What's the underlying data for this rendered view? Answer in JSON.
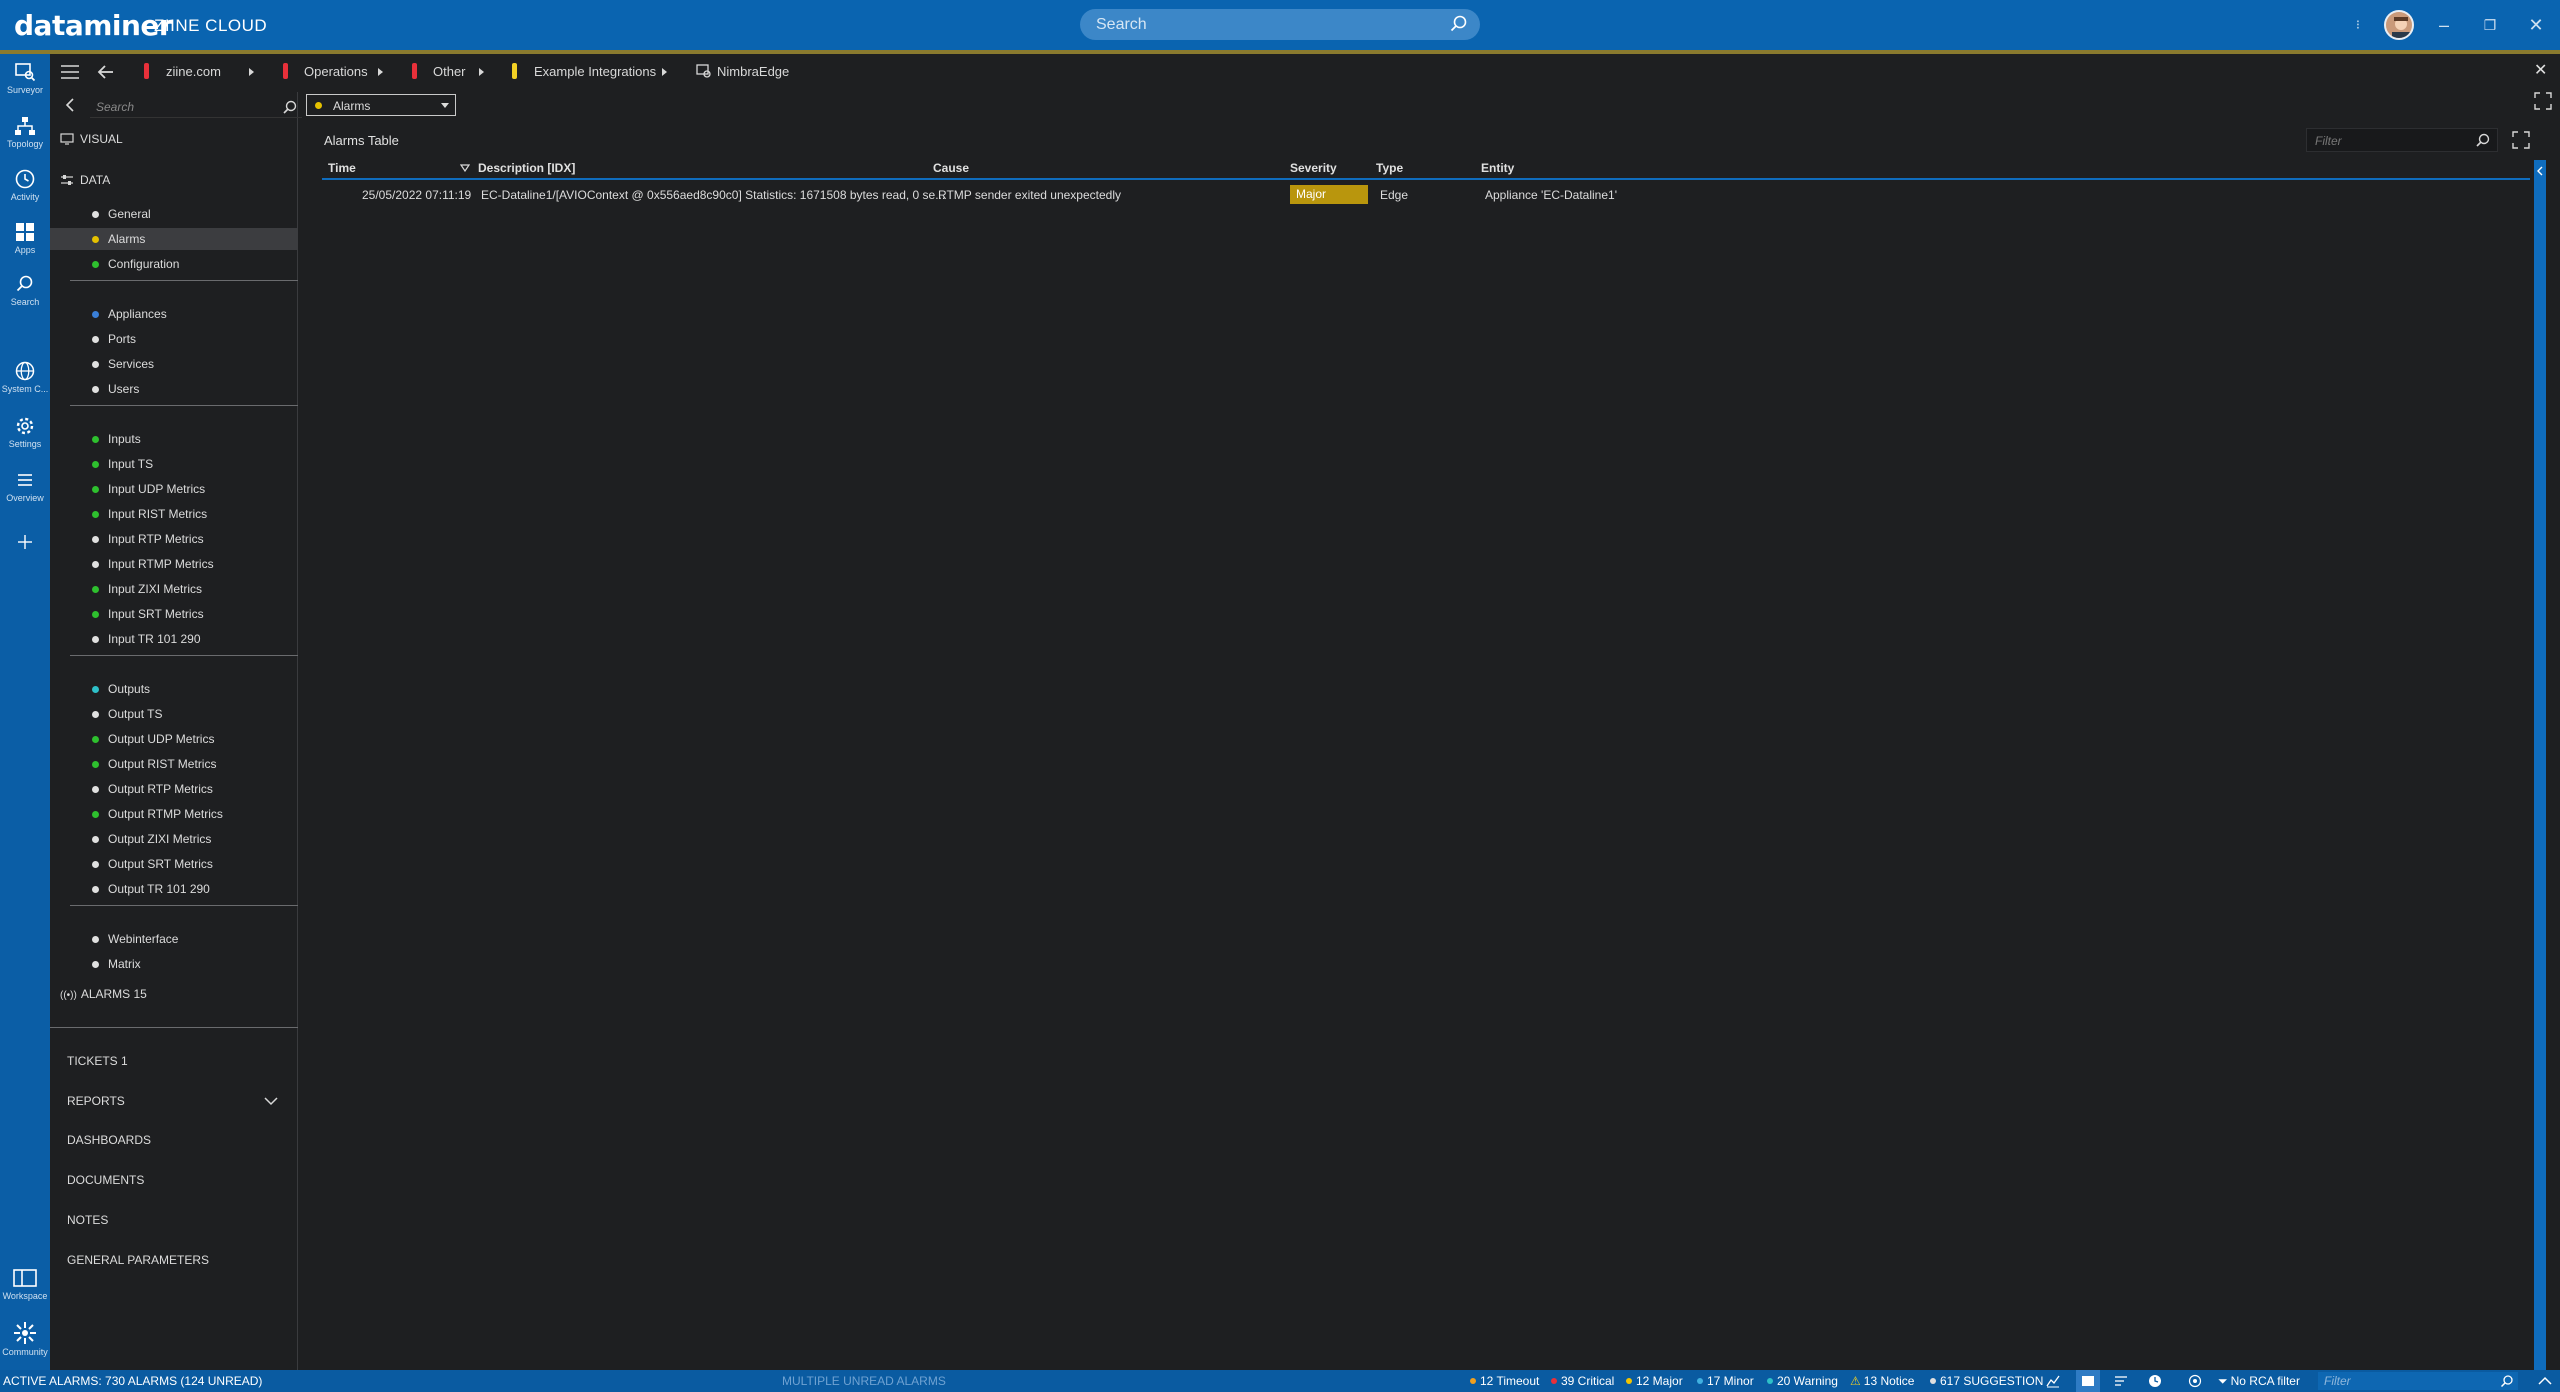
{
  "app": {
    "logo": "dataminer",
    "product": "ZIINE CLOUD"
  },
  "top_search": {
    "placeholder": "Search"
  },
  "rail": [
    {
      "label": "Surveyor",
      "icon": "surveyor-icon"
    },
    {
      "label": "Topology",
      "icon": "topology-icon"
    },
    {
      "label": "Activity",
      "icon": "activity-icon"
    },
    {
      "label": "Apps",
      "icon": "apps-icon"
    },
    {
      "label": "Search",
      "icon": "search-icon"
    },
    {
      "label": "System C...",
      "icon": "globe-icon"
    },
    {
      "label": "Settings",
      "icon": "gear-icon"
    },
    {
      "label": "Overview",
      "icon": "list-icon"
    },
    {
      "label": "",
      "icon": "plus-icon"
    },
    {
      "label": "Workspace",
      "icon": "workspace-icon"
    },
    {
      "label": "Community",
      "icon": "community-icon"
    }
  ],
  "breadcrumb": [
    {
      "label": "ziine.com",
      "flag": "#e8303a"
    },
    {
      "label": "Operations",
      "flag": "#e8303a"
    },
    {
      "label": "Other",
      "flag": "#e8303a"
    },
    {
      "label": "Example Integrations",
      "flag": "#f2d024"
    },
    {
      "label": "NimbraEdge"
    }
  ],
  "nav": {
    "search_placeholder": "Search",
    "visual_label": "VISUAL",
    "data_label": "DATA",
    "groups": [
      [
        {
          "label": "General",
          "color": "#e0e0e0"
        },
        {
          "label": "Alarms",
          "color": "#e5c100",
          "selected": true
        },
        {
          "label": "Configuration",
          "color": "#2ec02e"
        }
      ],
      [
        {
          "label": "Appliances",
          "color": "#3a7fd8"
        },
        {
          "label": "Ports",
          "color": "#e0e0e0"
        },
        {
          "label": "Services",
          "color": "#e0e0e0"
        },
        {
          "label": "Users",
          "color": "#e0e0e0"
        }
      ],
      [
        {
          "label": "Inputs",
          "color": "#2ec02e"
        },
        {
          "label": "Input TS",
          "color": "#2ec02e"
        },
        {
          "label": "Input UDP Metrics",
          "color": "#2ec02e"
        },
        {
          "label": "Input RIST Metrics",
          "color": "#2ec02e"
        },
        {
          "label": "Input RTP Metrics",
          "color": "#e0e0e0"
        },
        {
          "label": "Input RTMP Metrics",
          "color": "#e0e0e0"
        },
        {
          "label": "Input ZIXI Metrics",
          "color": "#2ec02e"
        },
        {
          "label": "Input SRT Metrics",
          "color": "#2ec02e"
        },
        {
          "label": "Input TR 101 290",
          "color": "#e0e0e0"
        }
      ],
      [
        {
          "label": "Outputs",
          "color": "#2ec0c8"
        },
        {
          "label": "Output TS",
          "color": "#e0e0e0"
        },
        {
          "label": "Output UDP Metrics",
          "color": "#2ec02e"
        },
        {
          "label": "Output RIST Metrics",
          "color": "#2ec02e"
        },
        {
          "label": "Output RTP Metrics",
          "color": "#e0e0e0"
        },
        {
          "label": "Output RTMP Metrics",
          "color": "#2ec02e"
        },
        {
          "label": "Output ZIXI Metrics",
          "color": "#e0e0e0"
        },
        {
          "label": "Output SRT Metrics",
          "color": "#e0e0e0"
        },
        {
          "label": "Output TR 101 290",
          "color": "#e0e0e0"
        }
      ],
      [
        {
          "label": "Webinterface",
          "color": "#e0e0e0"
        },
        {
          "label": "Matrix",
          "color": "#e0e0e0"
        }
      ]
    ],
    "alarms_label": "ALARMS 15",
    "tickets_label": "TICKETS 1",
    "reports_label": "REPORTS",
    "dashboards_label": "DASHBOARDS",
    "documents_label": "DOCUMENTS",
    "notes_label": "NOTES",
    "general_parameters_label": "GENERAL PARAMETERS"
  },
  "content": {
    "view_select": "Alarms",
    "section_title": "Alarms Table",
    "filter_placeholder": "Filter",
    "columns": [
      "Time",
      "Description [IDX]",
      "Cause",
      "Severity",
      "Type",
      "Entity"
    ],
    "rows": [
      {
        "time": "25/05/2022 07:11:19",
        "description": "EC-Dataline1/[AVIOContext @ 0x556aed8c90c0] Statistics: 1671508 bytes read, 0 se...",
        "cause": "RTMP sender exited unexpectedly",
        "severity": "Major",
        "type": "Edge",
        "entity": "Appliance 'EC-Dataline1'"
      }
    ]
  },
  "statusbar": {
    "active_alarms": "ACTIVE ALARMS: 730 ALARMS (124 UNREAD)",
    "center": "MULTIPLE UNREAD ALARMS",
    "timeout": "12 Timeout",
    "critical": "39 Critical",
    "major": "12 Major",
    "minor": "17 Minor",
    "warning": "20 Warning",
    "notice": "13 Notice",
    "suggestion": "617 SUGGESTION",
    "rca": "No RCA filter",
    "filter_placeholder": "Filter",
    "colors": {
      "timeout": "#f0a020",
      "critical": "#e8303a",
      "major": "#f2c400",
      "minor": "#40b0e0",
      "warning": "#2ec0c8",
      "notice": "#f2d024",
      "suggestion": "#e0e0e0"
    }
  }
}
